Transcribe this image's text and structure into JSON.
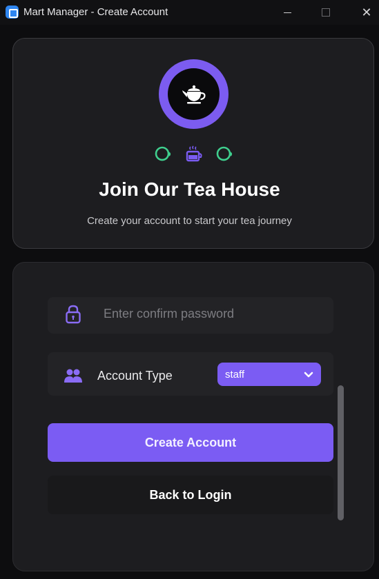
{
  "window": {
    "title": "Mart Manager - Create Account",
    "controls": {
      "minimize": "minimize-icon",
      "maximize": "maximize-icon",
      "close": "✕"
    }
  },
  "header": {
    "logo_icon": "teapot-icon",
    "accent_icons": [
      "tea-cup-icon",
      "hot-tea-icon",
      "tea-cup-icon"
    ],
    "title": "Join Our Tea House",
    "subtitle": "Create your account to start your tea journey"
  },
  "form": {
    "confirm_password": {
      "placeholder": "Enter confirm password",
      "value": "",
      "icon": "lock-icon"
    },
    "account_type": {
      "label": "Account Type",
      "icon": "users-icon",
      "selected": "staff"
    },
    "create_button": "Create Account",
    "back_button": "Back to Login"
  },
  "colors": {
    "accent": "#7b5cf3",
    "accent_green": "#3fcf8e",
    "background": "#0d0d0f",
    "card": "#1d1d20"
  }
}
